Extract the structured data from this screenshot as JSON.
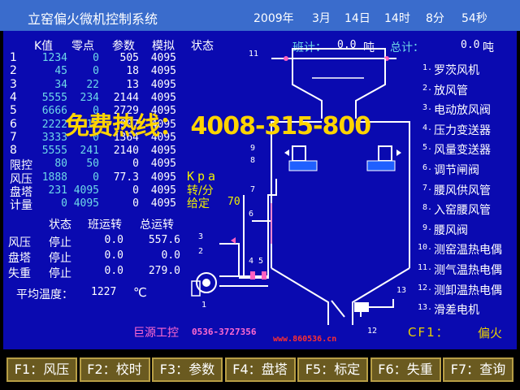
{
  "title": "立窑偏火微机控制系统",
  "datetime": {
    "year": "2009年",
    "month": "3月",
    "day": "14日",
    "hour": "14时",
    "minute": "8分",
    "second": "54秒"
  },
  "table": {
    "headers": [
      "K值",
      "零点",
      "参数",
      "模拟",
      "状态"
    ],
    "rows": [
      {
        "label": "1",
        "k": "1234",
        "zero": "0",
        "param": "505",
        "analog": "4095"
      },
      {
        "label": "2",
        "k": "45",
        "zero": "0",
        "param": "18",
        "analog": "4095"
      },
      {
        "label": "3",
        "k": "34",
        "zero": "22",
        "param": "13",
        "analog": "4095"
      },
      {
        "label": "4",
        "k": "5555",
        "zero": "234",
        "param": "2144",
        "analog": "4095"
      },
      {
        "label": "5",
        "k": "6666",
        "zero": "0",
        "param": "2729",
        "analog": "4095"
      },
      {
        "label": "6",
        "k": "2222",
        "zero": "12",
        "param": "907",
        "analog": "4095"
      },
      {
        "label": "7",
        "k": "3333",
        "zero": "0",
        "param": "1364",
        "analog": "4095"
      },
      {
        "label": "8",
        "k": "5555",
        "zero": "241",
        "param": "2140",
        "analog": "4095"
      },
      {
        "label": "限控",
        "k": "80",
        "zero": "50",
        "param": "0",
        "analog": "4095"
      },
      {
        "label": "风压",
        "k": "1888",
        "zero": "0",
        "param": "77.3",
        "analog": "4095"
      },
      {
        "label": "盘塔",
        "k": "231",
        "zero": "4095",
        "param": "0",
        "analog": "4095"
      },
      {
        "label": "计量",
        "k": "0",
        "zero": "4095",
        "param": "0",
        "analog": "4095"
      }
    ]
  },
  "units": {
    "kpa": "Kpa",
    "rpm": "转/分",
    "setpoint_label": "给定",
    "setpoint_value": "70"
  },
  "counters": {
    "shift_label": "班计：",
    "shift_value": "0.0",
    "shift_unit": "吨",
    "total_label": "总计：",
    "total_value": "0.0",
    "total_unit": "吨"
  },
  "status_table": {
    "headers": [
      "状态",
      "班运转",
      "总运转"
    ],
    "rows": [
      {
        "label": "风压",
        "state": "停止",
        "shift": "0.0",
        "total": "557.6"
      },
      {
        "label": "盘塔",
        "state": "停止",
        "shift": "0.0",
        "total": "0.0"
      },
      {
        "label": "失重",
        "state": "停止",
        "shift": "0.0",
        "total": "279.0"
      }
    ]
  },
  "avg_temp": {
    "label": "平均温度：",
    "value": "1227",
    "unit": "℃"
  },
  "legend": [
    {
      "num": "1.",
      "text": "罗茨风机"
    },
    {
      "num": "2.",
      "text": "放风管"
    },
    {
      "num": "3.",
      "text": "电动放风阀"
    },
    {
      "num": "4.",
      "text": "压力变送器"
    },
    {
      "num": "5.",
      "text": "风量变送器"
    },
    {
      "num": "6.",
      "text": "调节闸阀"
    },
    {
      "num": "7.",
      "text": "腰风供风管"
    },
    {
      "num": "8.",
      "text": "入窑腰风管"
    },
    {
      "num": "9.",
      "text": "腰风阀"
    },
    {
      "num": "10.",
      "text": "测窑温热电偶"
    },
    {
      "num": "11.",
      "text": "测气温热电偶"
    },
    {
      "num": "12.",
      "text": "测卸温热电偶"
    },
    {
      "num": "13.",
      "text": "滑差电机"
    }
  ],
  "cf1": {
    "label": "CF1：",
    "value": "偏火"
  },
  "company": {
    "name": "巨源工控",
    "phone": "0536-3727356",
    "url": "www.860536.cn"
  },
  "watermark": "免费热线： 4008-315-800",
  "diagram_labels": [
    "11",
    "9",
    "8",
    "7",
    "6",
    "3",
    "2",
    "5",
    "4",
    "1",
    "12",
    "13"
  ],
  "fkeys": [
    {
      "key": "F1：",
      "label": "风压"
    },
    {
      "key": "F2：",
      "label": "校时"
    },
    {
      "key": "F3：",
      "label": "参数"
    },
    {
      "key": "F4：",
      "label": "盘塔"
    },
    {
      "key": "F5：",
      "label": "标定"
    },
    {
      "key": "F6：",
      "label": "失重"
    },
    {
      "key": "F7：",
      "label": "查询"
    }
  ]
}
